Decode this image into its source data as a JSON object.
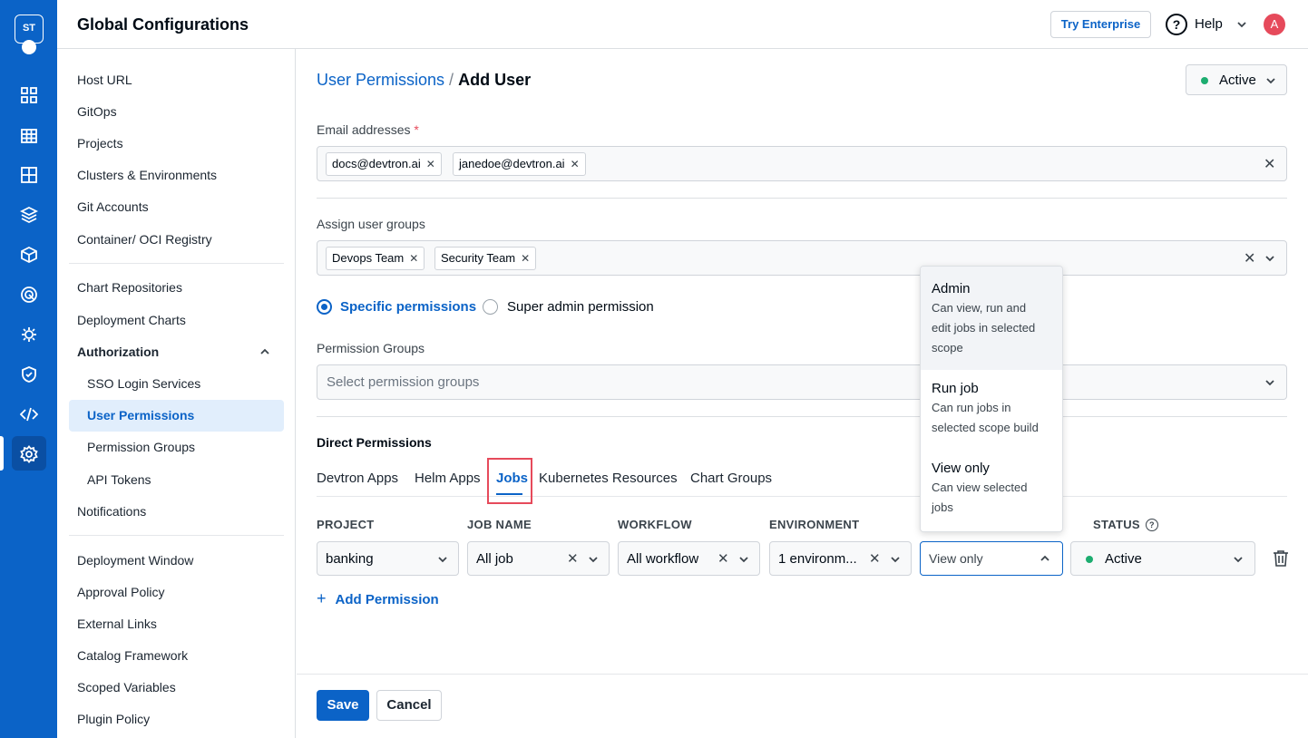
{
  "colors": {
    "brand": "#0b63c7",
    "rail": "#0b63c7",
    "success": "#1dad70",
    "danger": "#e64a5b"
  },
  "logo": {
    "text": "ST"
  },
  "header": {
    "title": "Global Configurations",
    "try_enterprise": "Try Enterprise",
    "help": "Help",
    "help_icon_glyph": "?",
    "avatar": "A"
  },
  "sidebar": {
    "items": [
      {
        "label": "Host URL"
      },
      {
        "label": "GitOps"
      },
      {
        "label": "Projects"
      },
      {
        "label": "Clusters & Environments"
      },
      {
        "label": "Git Accounts"
      },
      {
        "label": "Container/ OCI Registry"
      },
      {
        "label": "Chart Repositories"
      },
      {
        "label": "Deployment Charts"
      },
      {
        "label": "Authorization"
      },
      {
        "label": "SSO Login Services"
      },
      {
        "label": "User Permissions"
      },
      {
        "label": "Permission Groups"
      },
      {
        "label": "API Tokens"
      },
      {
        "label": "Notifications"
      },
      {
        "label": "Deployment Window"
      },
      {
        "label": "Approval Policy"
      },
      {
        "label": "External Links"
      },
      {
        "label": "Catalog Framework"
      },
      {
        "label": "Scoped Variables"
      },
      {
        "label": "Plugin Policy"
      }
    ]
  },
  "breadcrumb": {
    "parent": "User Permissions",
    "separator": "/",
    "current": "Add User"
  },
  "user_status": "Active",
  "email": {
    "label": "Email addresses",
    "required_mark": "*",
    "chips": [
      "docs@devtron.ai",
      "janedoe@devtron.ai"
    ]
  },
  "user_groups": {
    "label": "Assign user groups",
    "chips": [
      "Devops Team",
      "Security Team"
    ]
  },
  "permission_type": {
    "specific": "Specific permissions",
    "super_admin": "Super admin permission",
    "selected": "specific"
  },
  "permission_groups": {
    "label": "Permission Groups",
    "placeholder": "Select permission groups"
  },
  "direct_permissions": {
    "title": "Direct Permissions",
    "tabs": [
      "Devtron Apps",
      "Helm Apps",
      "Jobs",
      "Kubernetes Resources",
      "Chart Groups"
    ],
    "active_tab": "Jobs",
    "columns": {
      "project": "PROJECT",
      "job_name": "JOB NAME",
      "workflow": "WORKFLOW",
      "environment": "ENVIRONMENT",
      "status": "STATUS"
    },
    "row": {
      "project": "banking",
      "job_name": "All job",
      "workflow": "All workflow",
      "environment": "1 environm...",
      "role": "View only",
      "status": "Active"
    },
    "add_permission": "Add Permission"
  },
  "role_menu": {
    "options": [
      {
        "title": "Admin",
        "desc_lines": [
          "Can view, run and",
          "edit jobs in selected",
          "scope"
        ]
      },
      {
        "title": "Run job",
        "desc_lines": [
          "Can run jobs in",
          "selected scope build"
        ]
      },
      {
        "title": "View only",
        "desc_lines": [
          "Can view selected",
          "jobs"
        ]
      }
    ]
  },
  "footer": {
    "save": "Save",
    "cancel": "Cancel"
  },
  "glyphs": {
    "close": "✕",
    "plus": "+",
    "info": "?"
  }
}
